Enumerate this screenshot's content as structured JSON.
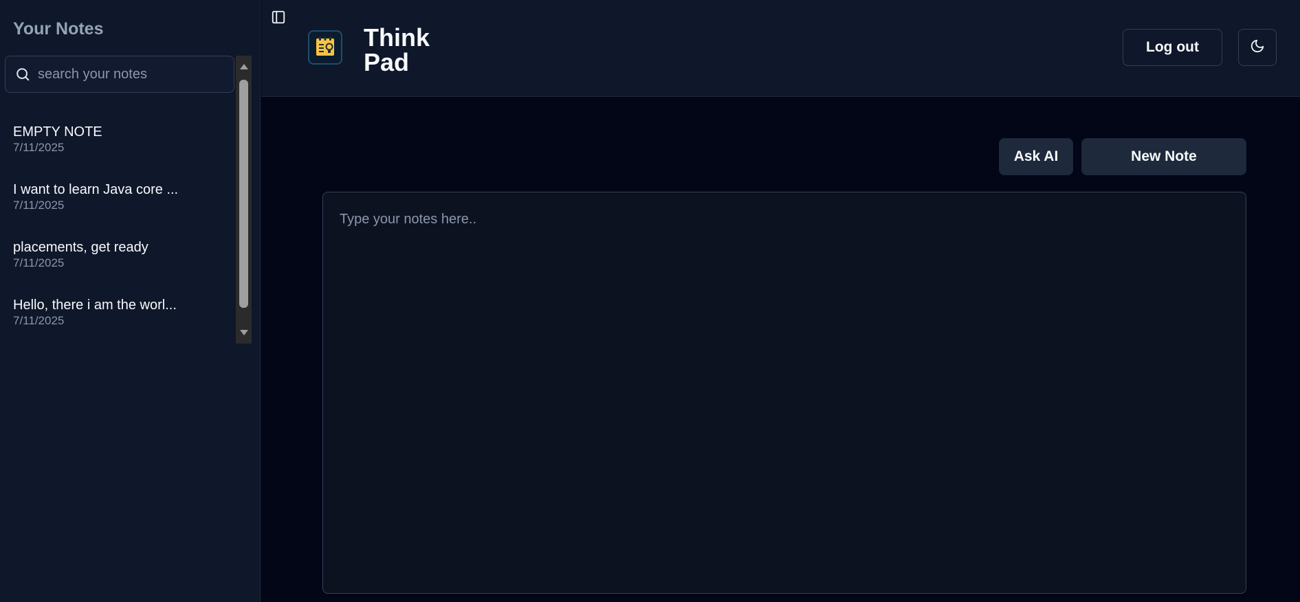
{
  "sidebar": {
    "title": "Your Notes",
    "search": {
      "placeholder": "search your notes",
      "value": ""
    },
    "notes": [
      {
        "title": "EMPTY NOTE",
        "date": "7/11/2025"
      },
      {
        "title": "I want to learn Java core ...",
        "date": "7/11/2025"
      },
      {
        "title": "placements, get ready",
        "date": "7/11/2025"
      },
      {
        "title": "Hello, there i am the worl...",
        "date": "7/11/2025"
      }
    ]
  },
  "header": {
    "app_title_line1": "Think",
    "app_title_line2": "Pad",
    "logout_label": "Log out",
    "theme_icon": "moon-icon",
    "toggle_icon": "sidebar-toggle-icon",
    "logo_icon": "notepad-lightbulb-icon"
  },
  "main": {
    "ask_ai_label": "Ask AI",
    "new_note_label": "New Note",
    "editor": {
      "placeholder": "Type your notes here..",
      "value": ""
    }
  },
  "colors": {
    "background": "#020617",
    "panel": "#0f172a",
    "button": "#1e293b",
    "border": "#334155",
    "logo_accent": "#f5c542"
  }
}
